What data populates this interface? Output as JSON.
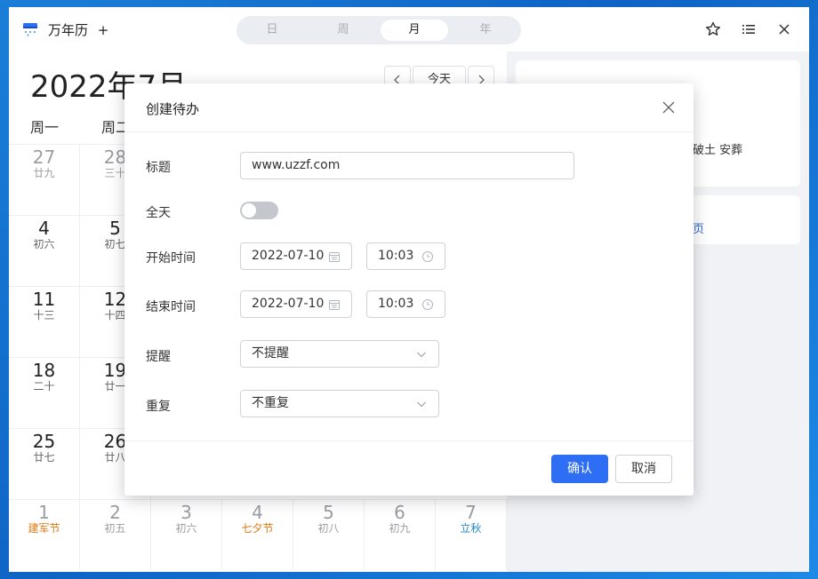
{
  "window": {
    "title": "万年历",
    "add_tab": "+"
  },
  "view_tabs": [
    {
      "label": "日",
      "active": false
    },
    {
      "label": "周",
      "active": false
    },
    {
      "label": "月",
      "active": true
    },
    {
      "label": "年",
      "active": false
    }
  ],
  "calendar": {
    "month_title": "2022年7月",
    "today_button": "今天",
    "weekdays": [
      "周一",
      "周二"
    ],
    "rows": [
      [
        {
          "day": "27",
          "lunar": "廿九",
          "other": true
        },
        {
          "day": "28",
          "lunar": "三十",
          "other": true
        }
      ],
      [
        {
          "day": "4",
          "lunar": "初六"
        },
        {
          "day": "5",
          "lunar": "初七"
        }
      ],
      [
        {
          "day": "11",
          "lunar": "十三"
        },
        {
          "day": "12",
          "lunar": "十四"
        }
      ],
      [
        {
          "day": "18",
          "lunar": "二十"
        },
        {
          "day": "19",
          "lunar": "廿一"
        }
      ],
      [
        {
          "day": "25",
          "lunar": "廿七"
        },
        {
          "day": "26",
          "lunar": "廿八"
        }
      ]
    ],
    "last_row": [
      {
        "day": "1",
        "lunar": "建军节",
        "color": "orange"
      },
      {
        "day": "2",
        "lunar": "初五"
      },
      {
        "day": "3",
        "lunar": "初六"
      },
      {
        "day": "4",
        "lunar": "七夕节",
        "color": "orange"
      },
      {
        "day": "5",
        "lunar": "初八"
      },
      {
        "day": "6",
        "lunar": "初九"
      },
      {
        "day": "7",
        "lunar": "立秋",
        "color": "blue"
      }
    ]
  },
  "side": {
    "text": "破土 安葬",
    "link": "页"
  },
  "dialog": {
    "title": "创建待办",
    "fields": {
      "title_label": "标题",
      "title_value": "www.uzzf.com",
      "allday_label": "全天",
      "start_label": "开始时间",
      "start_date": "2022-07-10",
      "start_time": "10:03",
      "end_label": "结束时间",
      "end_date": "2022-07-10",
      "end_time": "10:03",
      "remind_label": "提醒",
      "remind_value": "不提醒",
      "repeat_label": "重复",
      "repeat_value": "不重复"
    },
    "allday_on": false,
    "ok_label": "确认",
    "cancel_label": "取消"
  },
  "colors": {
    "accent": "#2d6ef5",
    "festival_orange": "#e07a11",
    "solar_term_blue": "#1e86c8"
  }
}
